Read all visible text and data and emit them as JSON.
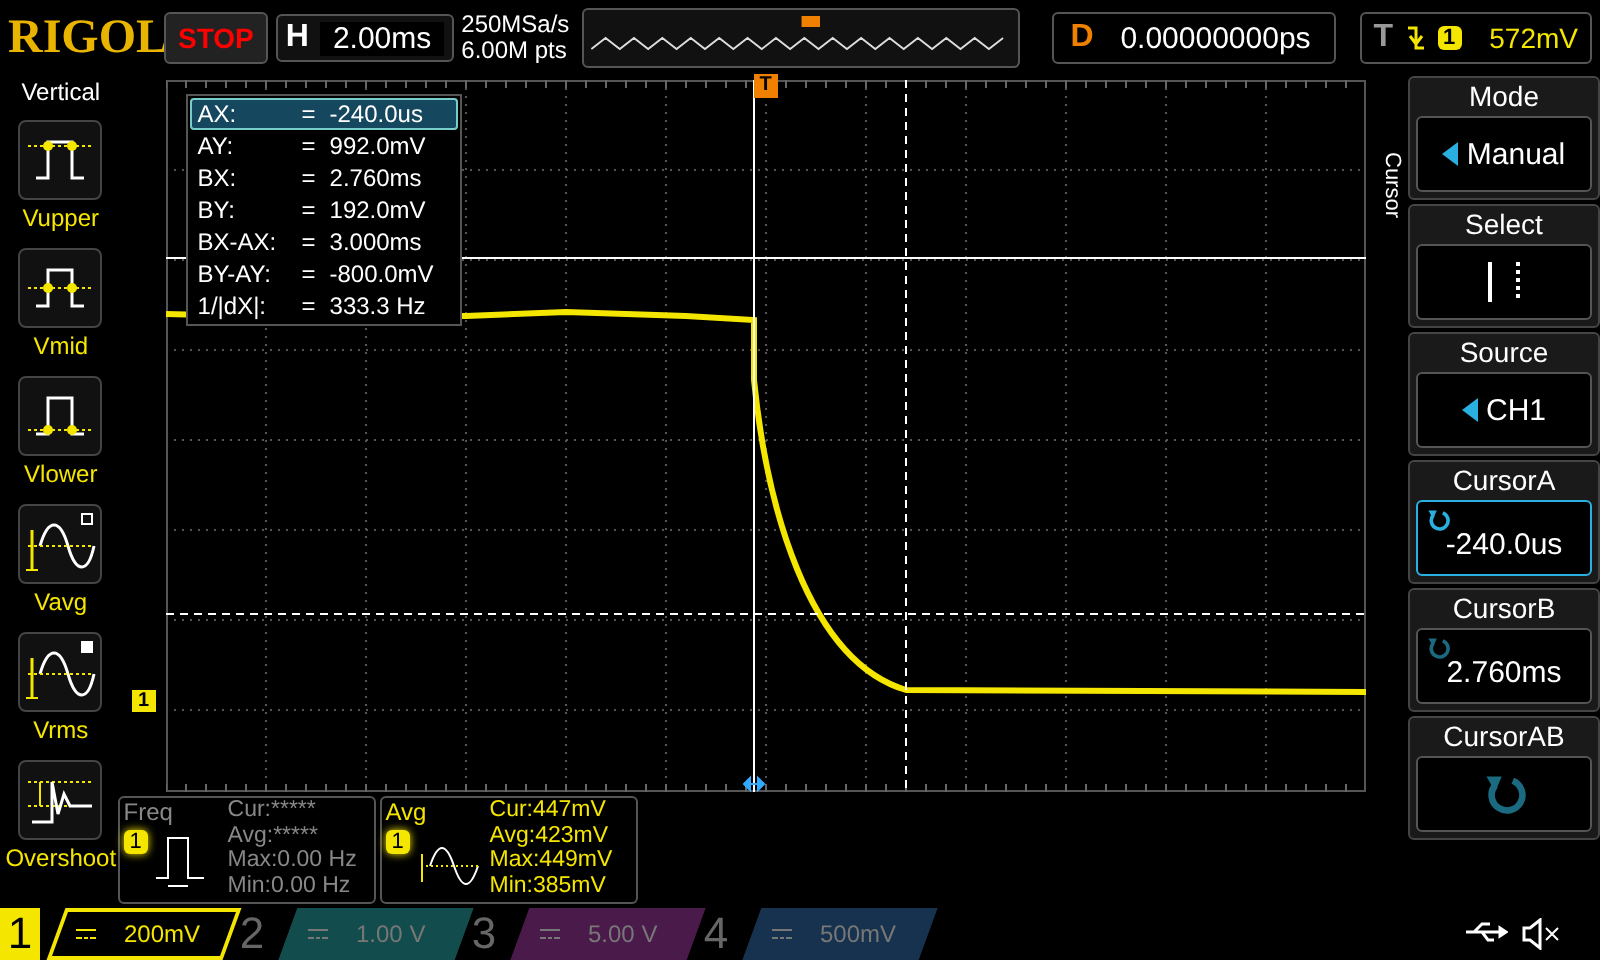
{
  "top_bar": {
    "logo": "RIGOL",
    "run_state": "STOP",
    "stopped": true,
    "horizontal": {
      "label": "H",
      "timebase": "2.00ms"
    },
    "sample_rate": "250MSa/s",
    "memory_depth": "6.00M pts",
    "delay": {
      "label": "D",
      "value": "0.00000000ps"
    },
    "trigger": {
      "label": "T",
      "source": "1",
      "level": "572mV"
    }
  },
  "left_menu": {
    "title": "Vertical",
    "items": [
      {
        "kind": "vupper",
        "label": "Vupper"
      },
      {
        "kind": "vmid",
        "label": "Vmid"
      },
      {
        "kind": "vlower",
        "label": "Vlower"
      },
      {
        "kind": "vavg",
        "label": "Vavg"
      },
      {
        "kind": "vrms",
        "label": "Vrms"
      },
      {
        "kind": "overshoot",
        "label": "Overshoot"
      }
    ]
  },
  "graticule": {
    "trigger_marker": "T",
    "channel_marker": "1"
  },
  "cursor_readout": [
    {
      "label": "AX:",
      "sign": "=",
      "value": "-240.0us",
      "selected": true
    },
    {
      "label": "AY:",
      "sign": "=",
      "value": "992.0mV",
      "selected": false
    },
    {
      "label": "BX:",
      "sign": "=",
      "value": "2.760ms",
      "selected": false
    },
    {
      "label": "BY:",
      "sign": "=",
      "value": "192.0mV",
      "selected": false
    },
    {
      "label": "BX-AX:",
      "sign": "=",
      "value": "3.000ms",
      "selected": false
    },
    {
      "label": "BY-AY:",
      "sign": "=",
      "value": "-800.0mV",
      "selected": false
    },
    {
      "label": "1/|dX|:",
      "sign": "=",
      "value": "333.3 Hz",
      "selected": false
    }
  ],
  "measurements": [
    {
      "kind": "freq",
      "title": "Freq",
      "source": "1",
      "valid": false,
      "stats": [
        "Cur:*****",
        "Avg:*****",
        "Max:0.00 Hz",
        "Min:0.00 Hz"
      ]
    },
    {
      "kind": "avg",
      "title": "Avg",
      "source": "1",
      "valid": true,
      "stats": [
        "Cur:447mV",
        "Avg:423mV",
        "Max:449mV",
        "Min:385mV"
      ]
    }
  ],
  "right_menu": {
    "title": "Cursor",
    "items": [
      {
        "kind": "choice",
        "title": "Mode",
        "value": "Manual",
        "selected": false
      },
      {
        "kind": "select",
        "title": "Select",
        "selected": false
      },
      {
        "kind": "choice",
        "title": "Source",
        "value": "CH1",
        "selected": false
      },
      {
        "kind": "knob",
        "title": "CursorA",
        "value": "-240.0us",
        "selected": true
      },
      {
        "kind": "knob",
        "title": "CursorB",
        "value": "2.760ms",
        "selected": false
      },
      {
        "kind": "action",
        "title": "CursorAB",
        "selected": false
      }
    ]
  },
  "channels": [
    {
      "number": "1",
      "scale": "200mV",
      "on": true,
      "color": "#f5e600"
    },
    {
      "number": "2",
      "scale": "1.00 V",
      "on": false,
      "color": "#124c4c"
    },
    {
      "number": "3",
      "scale": "5.00 V",
      "on": false,
      "color": "#4a1a4a"
    },
    {
      "number": "4",
      "scale": "500mV",
      "on": false,
      "color": "#16324e"
    }
  ]
}
